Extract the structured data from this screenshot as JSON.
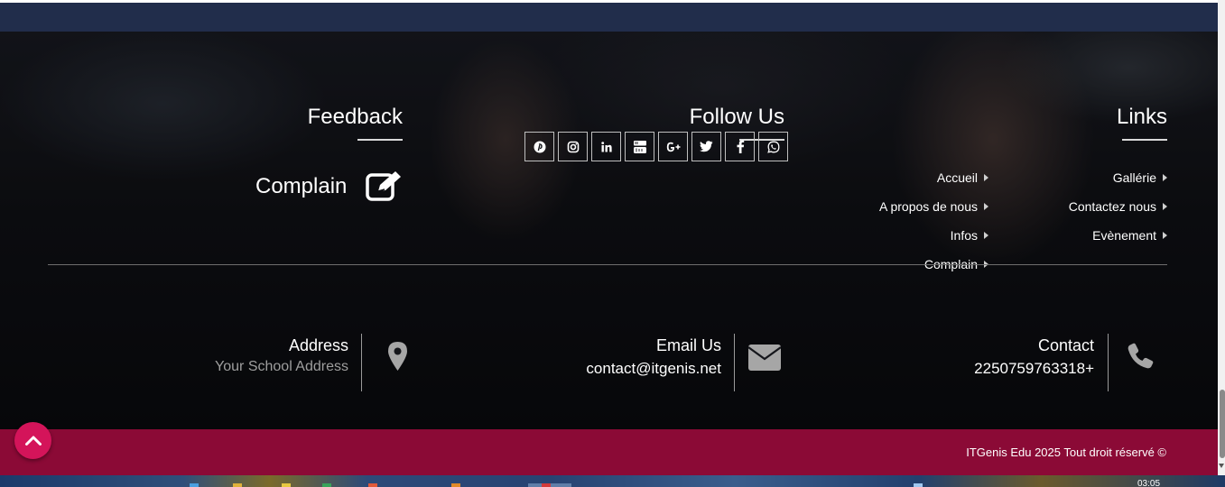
{
  "feedback": {
    "title": "Feedback",
    "complain_label": "Complain"
  },
  "follow": {
    "title": "Follow Us",
    "socials": [
      "pinterest-icon",
      "instagram-icon",
      "linkedin-icon",
      "youtube-icon",
      "google-plus-icon",
      "twitter-icon",
      "facebook-icon",
      "whatsapp-icon"
    ],
    "glyphs": [
      "℗",
      "◎",
      "in",
      "You",
      "G+",
      "t",
      "f",
      "✆"
    ]
  },
  "links": {
    "title": "Links",
    "col1": [
      "Accueil",
      "A propos de nous",
      "Infos",
      "Complain"
    ],
    "col2": [
      "Gallérie",
      "Contactez nous",
      "Evènement"
    ]
  },
  "contact_info": {
    "address": {
      "title": "Address",
      "value": "Your School Address"
    },
    "email": {
      "title": "Email Us",
      "value": "contact@itgenis.net"
    },
    "phone": {
      "title": "Contact",
      "value": "2250759763318+"
    }
  },
  "copyright": "ITGenis Edu 2025 Tout droit réservé ©",
  "taskbar": {
    "clock": "03:05"
  },
  "colors": {
    "navy": "#212d4b",
    "crimson": "#8b0a36",
    "back_to_top": "#d4145a"
  }
}
